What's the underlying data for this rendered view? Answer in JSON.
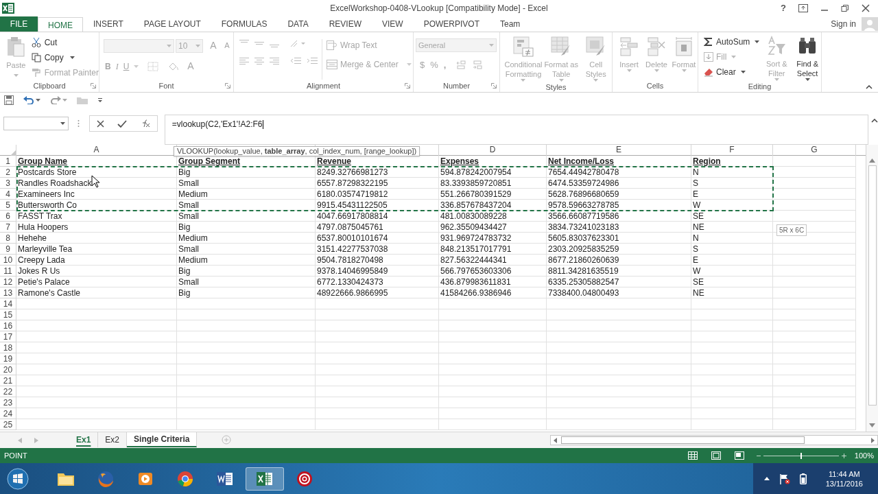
{
  "window": {
    "title": "ExcelWorkshop-0408-VLookup  [Compatibility Mode] - Excel",
    "help": "?"
  },
  "ribbon_tabs": [
    {
      "label": "FILE",
      "kind": "file",
      "selected": false
    },
    {
      "label": "HOME",
      "kind": "tab",
      "selected": true
    },
    {
      "label": "INSERT",
      "kind": "tab",
      "selected": false
    },
    {
      "label": "PAGE LAYOUT",
      "kind": "tab",
      "selected": false
    },
    {
      "label": "FORMULAS",
      "kind": "tab",
      "selected": false
    },
    {
      "label": "DATA",
      "kind": "tab",
      "selected": false
    },
    {
      "label": "REVIEW",
      "kind": "tab",
      "selected": false
    },
    {
      "label": "VIEW",
      "kind": "tab",
      "selected": false
    },
    {
      "label": "POWERPIVOT",
      "kind": "tab",
      "selected": false
    },
    {
      "label": "Team",
      "kind": "tab",
      "selected": false
    }
  ],
  "account": {
    "label": "Sign in"
  },
  "ribbon": {
    "clipboard": {
      "label": "Clipboard",
      "paste": {
        "label": "Paste",
        "disabled": true
      },
      "cut": {
        "label": "Cut",
        "disabled": false
      },
      "copy": {
        "label": "Copy",
        "disabled": false
      },
      "format_painter": {
        "label": "Format Painter",
        "disabled": true
      }
    },
    "font": {
      "label": "Font",
      "size": "10",
      "grow": "A",
      "shrink": "A",
      "bold": "B",
      "italic": "I",
      "underline": "U",
      "text_color": "A",
      "disabled": true
    },
    "alignment": {
      "label": "Alignment",
      "wrap_text": "Wrap Text",
      "merge": "Merge & Center",
      "disabled": true
    },
    "number": {
      "label": "Number",
      "format": "General",
      "currency": "$",
      "percent": "%",
      "comma": ",",
      "disabled": true
    },
    "styles": {
      "label": "Styles",
      "buttons": [
        {
          "label": "Conditional Formatting",
          "disabled": true
        },
        {
          "label": "Format as Table",
          "disabled": true
        },
        {
          "label": "Cell Styles",
          "disabled": true
        }
      ]
    },
    "cells": {
      "label": "Cells",
      "buttons": [
        {
          "label": "Insert",
          "disabled": true
        },
        {
          "label": "Delete",
          "disabled": true
        },
        {
          "label": "Format",
          "disabled": true
        }
      ]
    },
    "editing": {
      "label": "Editing",
      "autosum": {
        "label": "AutoSum",
        "disabled": false
      },
      "fill": {
        "label": "Fill",
        "disabled": true
      },
      "clear": {
        "label": "Clear",
        "disabled": false
      },
      "sort": {
        "label": "Sort & Filter",
        "disabled": true
      },
      "find": {
        "label": "Find & Select",
        "disabled": false
      }
    }
  },
  "formula_bar": {
    "formula": "=vlookup(C2,'Ex1'!A2:F6",
    "hint": "VLOOKUP(lookup_value, **table_array**, col_index_num, [range_lookup])"
  },
  "table": {
    "columns": [
      "A",
      null,
      null,
      "D",
      "E",
      "F",
      "G"
    ],
    "header_row": {
      "number": "1",
      "cells": [
        "Group Name",
        "Group Segment",
        "Revenue",
        "Expenses",
        "Net Income/Loss",
        "Region"
      ]
    },
    "rows": [
      {
        "number": "2",
        "marked": true,
        "cells": [
          "Postcards Store",
          "Big",
          "8249.32766981273",
          "594.878242007954",
          "7654.44942780478",
          "N"
        ]
      },
      {
        "number": "3",
        "marked": true,
        "cells": [
          "Randles Roadshack",
          "Small",
          "6557.87298322195",
          "83.3393859720851",
          "6474.53359724986",
          "S"
        ]
      },
      {
        "number": "4",
        "marked": true,
        "cells": [
          "Examineers Inc",
          "Medium",
          "6180.03574719812",
          "551.266780391529",
          "5628.76896680659",
          "E"
        ]
      },
      {
        "number": "5",
        "marked": true,
        "cells": [
          "Buttersworth Co",
          "Small",
          "9915.45431122505",
          "336.857678437204",
          "9578.59663278785",
          "W"
        ]
      },
      {
        "number": "6",
        "marked": false,
        "cells": [
          "FASST Trax",
          "Small",
          "4047.66917808814",
          "481.00830089228",
          "3566.66087719586",
          "SE"
        ]
      },
      {
        "number": "7",
        "marked": false,
        "cells": [
          "Hula Hoopers",
          "Big",
          "4797.0875045761",
          "962.35509434427",
          "3834.73241023183",
          "NE"
        ]
      },
      {
        "number": "8",
        "marked": false,
        "cells": [
          "Hehehe",
          "Medium",
          "6537.80010101674",
          "931.969724783732",
          "5605.83037623301",
          "N"
        ]
      },
      {
        "number": "9",
        "marked": false,
        "cells": [
          "Marleyville Tea",
          "Small",
          "3151.42277537038",
          "848.213517017791",
          "2303.20925835259",
          "S"
        ]
      },
      {
        "number": "10",
        "marked": false,
        "cells": [
          "Creepy Lada",
          "Medium",
          "9504.7818270498",
          "827.56322444341",
          "8677.21860260639",
          "E"
        ]
      },
      {
        "number": "11",
        "marked": false,
        "cells": [
          "Jokes R Us",
          "Big",
          "9378.14046995849",
          "566.797653603306",
          "8811.34281635519",
          "W"
        ]
      },
      {
        "number": "12",
        "marked": false,
        "cells": [
          "Petie's Palace",
          "Small",
          "6772.1330424373",
          "436.879983611831",
          "6335.25305882547",
          "SE"
        ]
      },
      {
        "number": "13",
        "marked": false,
        "cells": [
          "Ramone's Castle",
          "Big",
          "48922666.9866995",
          "41584266.9386946",
          "7338400.04800493",
          "NE"
        ]
      },
      {
        "number": "14",
        "marked": false
      },
      {
        "number": "15",
        "marked": false
      },
      {
        "number": "16",
        "marked": false
      },
      {
        "number": "17",
        "marked": false
      },
      {
        "number": "18",
        "marked": false
      },
      {
        "number": "19",
        "marked": false
      },
      {
        "number": "20",
        "marked": false
      },
      {
        "number": "21",
        "marked": false
      },
      {
        "number": "22",
        "marked": false
      },
      {
        "number": "23",
        "marked": false
      },
      {
        "number": "24",
        "marked": false
      },
      {
        "number": "25",
        "marked": false
      }
    ],
    "range_size": "5R x 6C"
  },
  "sheet_tabs": [
    {
      "label": "Ex1",
      "selected": true,
      "active": false
    },
    {
      "label": "Ex2",
      "selected": false,
      "active": false
    },
    {
      "label": "Single Criteria",
      "selected": false,
      "active": true
    }
  ],
  "status_bar": {
    "mode": "POINT",
    "zoom": "100%",
    "zoom_slider": {
      "level": 0.5
    }
  },
  "taskbar": {
    "apps": [
      {
        "kind": "folder",
        "active": false
      },
      {
        "kind": "firefox",
        "active": false
      },
      {
        "kind": "media",
        "active": false
      },
      {
        "kind": "chrome",
        "active": false
      },
      {
        "kind": "word",
        "active": false
      },
      {
        "kind": "excel",
        "active": true
      },
      {
        "kind": "target",
        "active": false
      }
    ],
    "time": "11:44 AM",
    "date": "13/11/2016"
  }
}
